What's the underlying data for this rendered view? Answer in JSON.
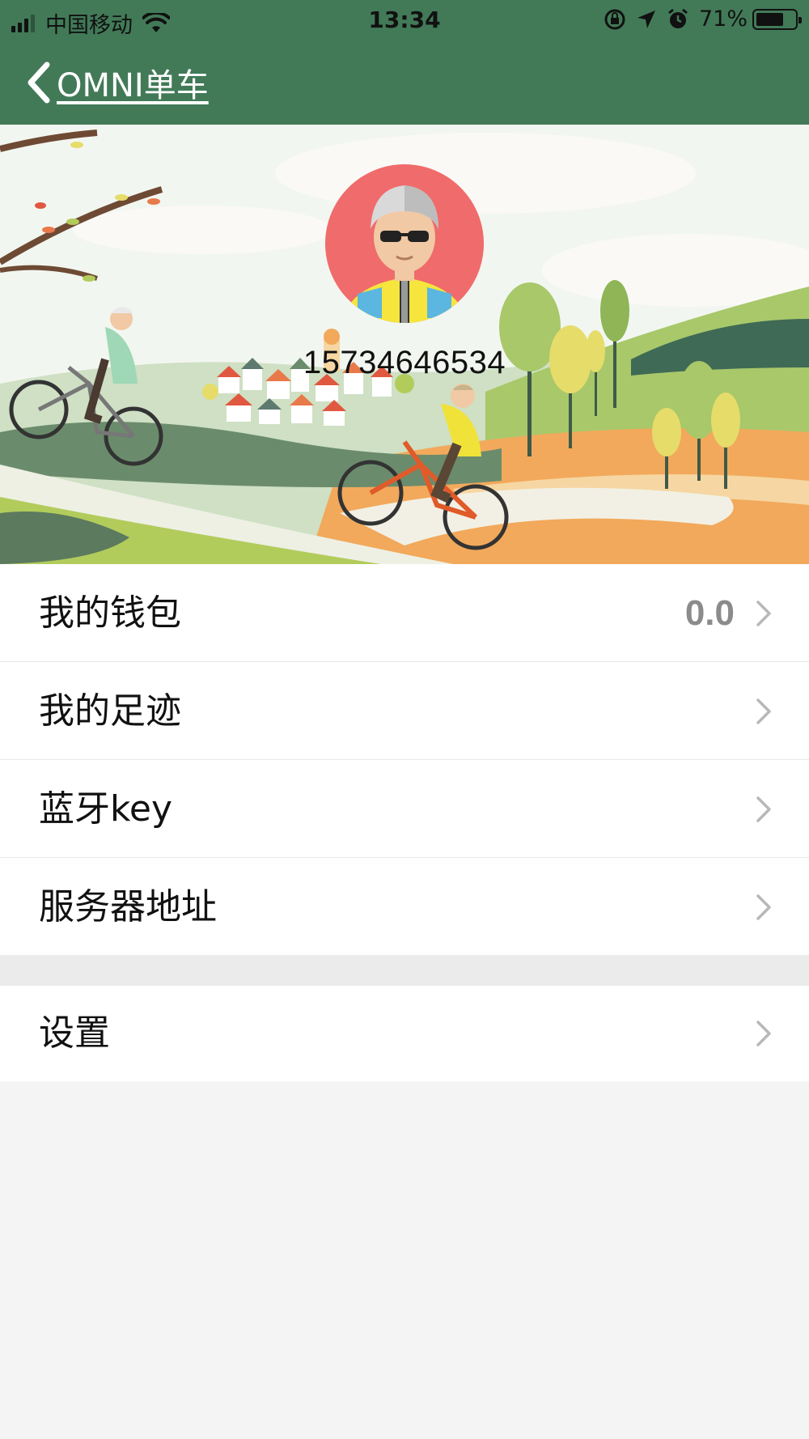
{
  "status_bar": {
    "carrier": "中国移动",
    "time": "13:34",
    "battery": "71%",
    "battery_level": 0.71,
    "icons": [
      "signal-icon",
      "wifi-icon",
      "rotation-lock-icon",
      "location-icon",
      "alarm-icon",
      "battery-icon"
    ]
  },
  "nav": {
    "back_icon": "chevron-left-icon",
    "title": "OMNI单车"
  },
  "profile": {
    "phone": "15734646534",
    "avatar_icon": "avatar-icon"
  },
  "menu": {
    "items": [
      {
        "label": "我的钱包",
        "value": "0.0"
      },
      {
        "label": "我的足迹",
        "value": ""
      },
      {
        "label": "蓝牙key",
        "value": ""
      },
      {
        "label": "服务器地址",
        "value": ""
      }
    ],
    "settings": {
      "label": "设置"
    }
  },
  "colors": {
    "nav_green": "#427a58",
    "page_bg": "#f4f4f4",
    "value_gray": "#8b8b8b"
  }
}
